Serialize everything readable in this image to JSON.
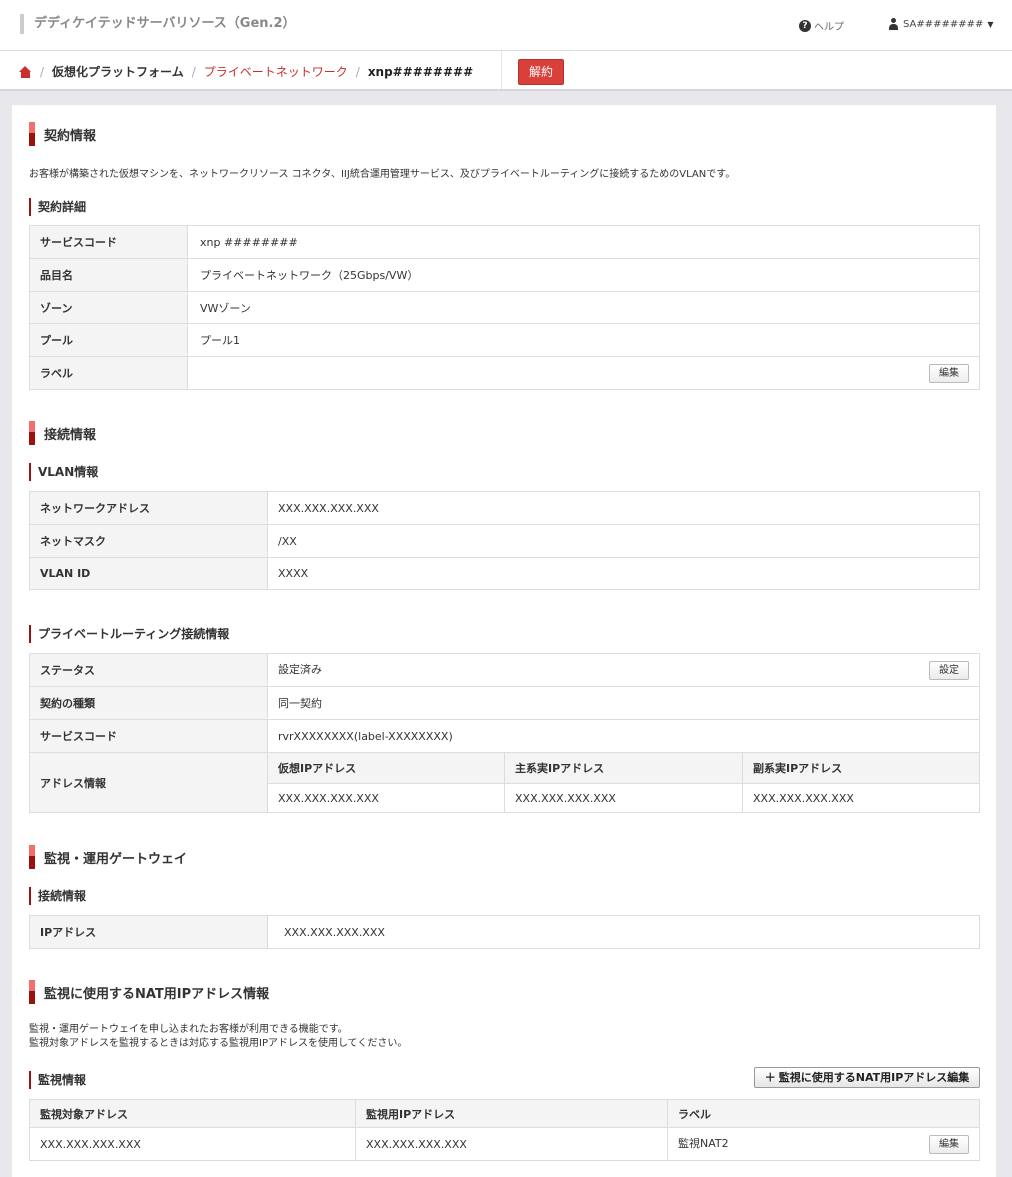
{
  "header": {
    "app_title": "デディケイテッドサーバリソース（Gen.2）",
    "help_label": "ヘルプ",
    "user_label": "SA########"
  },
  "breadcrumb": {
    "items": [
      "仮想化プラットフォーム",
      "プライベートネットワーク",
      "xnp########"
    ],
    "cancel_label": "解約"
  },
  "contract": {
    "title": "契約情報",
    "description": "お客様が構築された仮想マシンを、ネットワークリソース コネクタ、IIJ統合運用管理サービス、及びプライベートルーティングに接続するためのVLANです。",
    "details_title": "契約詳細",
    "rows": [
      {
        "key": "サービスコード",
        "value": "xnp ########"
      },
      {
        "key": "品目名",
        "value": "プライベートネットワーク（25Gbps/VW）"
      },
      {
        "key": "ゾーン",
        "value": "VWゾーン"
      },
      {
        "key": "プール",
        "value": "プール1"
      },
      {
        "key": "ラベル",
        "value": ""
      }
    ],
    "edit_label": "編集"
  },
  "connection": {
    "title": "接続情報",
    "vlan_title": "VLAN情報",
    "vlan_rows": [
      {
        "key": "ネットワークアドレス",
        "value": "XXX.XXX.XXX.XXX"
      },
      {
        "key": "ネットマスク",
        "value": "/XX"
      },
      {
        "key": "VLAN ID",
        "value": "XXXX"
      }
    ],
    "routing_title": "プライベートルーティング接続情報",
    "routing_rows": [
      {
        "key": "ステータス",
        "value": "設定済み"
      },
      {
        "key": "契約の種類",
        "value": "同一契約"
      },
      {
        "key": "サービスコード",
        "value": "rvrXXXXXXXX(label-XXXXXXXX)"
      }
    ],
    "setting_label": "設定",
    "address_key": "アドレス情報",
    "address_headers": [
      "仮想IPアドレス",
      "主系実IPアドレス",
      "副系実IPアドレス"
    ],
    "address_values": [
      "XXX.XXX.XXX.XXX",
      "XXX.XXX.XXX.XXX",
      "XXX.XXX.XXX.XXX"
    ]
  },
  "gateway": {
    "title": "監視・運用ゲートウェイ",
    "sub_title": "接続情報",
    "ip_key": "IPアドレス",
    "ip_value": "XXX.XXX.XXX.XXX"
  },
  "nat": {
    "title": "監視に使用するNAT用IPアドレス情報",
    "description_1": "監視・運用ゲートウェイを申し込まれたお客様が利用できる機能です。",
    "description_2": "監視対象アドレスを監視するときは対応する監視用IPアドレスを使用してください。",
    "monitor_title": "監視情報",
    "edit_button_label": "監視に使用するNAT用IPアドレス編集",
    "headers": [
      "監視対象アドレス",
      "監視用IPアドレス",
      "ラベル"
    ],
    "rows": [
      {
        "target": "XXX.XXX.XXX.XXX",
        "monitor_ip": "XXX.XXX.XXX.XXX",
        "label": "監視NAT2"
      }
    ],
    "edit_label": "編集"
  }
}
